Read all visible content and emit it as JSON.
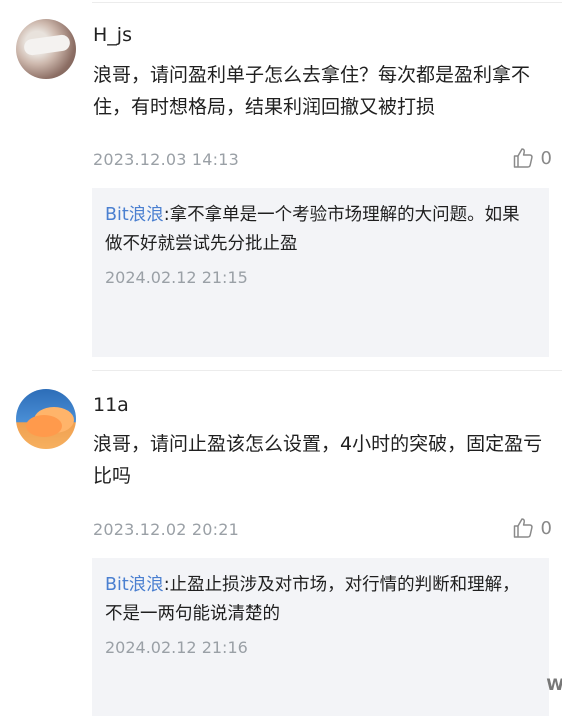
{
  "comments": [
    {
      "username": "H_js",
      "content": "浪哥，请问盈利单子怎么去拿住？每次都是盈利拿不住，有时想格局，结果利润回撤又被打损",
      "time": "2023.12.03 14:13",
      "likes": "0",
      "reply": {
        "author": "Bit浪浪",
        "text": ":拿不拿单是一个考验市场理解的大问题。如果做不好就尝试先分批止盈",
        "time": "2024.02.12 21:15"
      }
    },
    {
      "username": "11a",
      "content": "浪哥，请问止盈该怎么设置，4小时的突破，固定盈亏比吗",
      "time": "2023.12.02 20:21",
      "likes": "0",
      "reply": {
        "author": "Bit浪浪",
        "text": ":止盈止损涉及对市场，对行情的判断和理解，不是一两句能说清楚的",
        "time": "2024.02.12 21:16"
      }
    }
  ],
  "icons": {
    "like": "thumbs-up-icon",
    "reply_author_color": "#4a7fd0"
  },
  "watermark": "W"
}
